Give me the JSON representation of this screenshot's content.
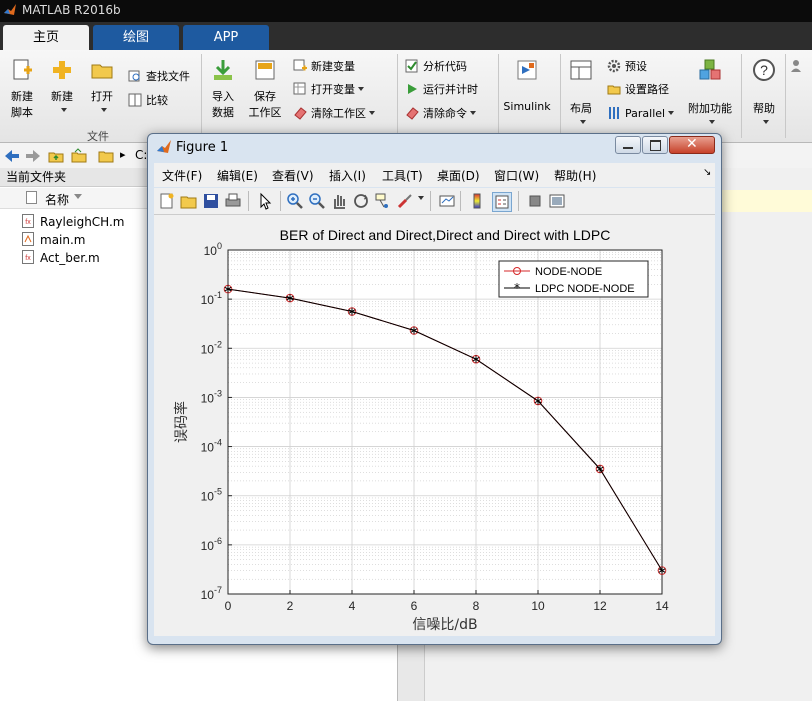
{
  "app": {
    "title": "MATLAB R2016b"
  },
  "tabs": [
    {
      "label": "主页"
    },
    {
      "label": "绘图"
    },
    {
      "label": "APP"
    }
  ],
  "ribbon": {
    "new_script": [
      "新建",
      "脚本"
    ],
    "new": "新建",
    "open": "打开",
    "find_files": "查找文件",
    "compare": "比较",
    "import": [
      "导入",
      "数据"
    ],
    "save_ws": [
      "保存",
      "工作区"
    ],
    "new_var": "新建变量",
    "open_var": "打开变量",
    "clear_ws": "清除工作区",
    "analyze_code": "分析代码",
    "run_time": "运行并计时",
    "clear_cmd": "清除命令",
    "simulink": "Simulink",
    "layout": "布局",
    "prefs": "预设",
    "set_path": "设置路径",
    "parallel": "Parallel",
    "addons": "附加功能",
    "help": "帮助",
    "group_file": "文件"
  },
  "address": {
    "path": "C:"
  },
  "current_folder": {
    "header": "当前文件夹",
    "col_name": "名称",
    "files": [
      {
        "name": "RayleighCH.m"
      },
      {
        "name": "main.m"
      },
      {
        "name": "Act_ber.m"
      }
    ]
  },
  "figure": {
    "title": "Figure 1",
    "menu": [
      "文件(F)",
      "编辑(E)",
      "查看(V)",
      "插入(I)",
      "工具(T)",
      "桌面(D)",
      "窗口(W)",
      "帮助(H)"
    ]
  },
  "chart_data": {
    "type": "line",
    "title": "BER of Direct and Direct,Direct and Direct with LDPC",
    "xlabel": "信噪比/dB",
    "ylabel": "误码率",
    "xlim": [
      0,
      14
    ],
    "ylim": [
      1e-07,
      1
    ],
    "yscale": "log",
    "grid": true,
    "legend_position": "top-right",
    "x_ticks": [
      "0",
      "2",
      "4",
      "6",
      "8",
      "10",
      "12",
      "14"
    ],
    "y_tick_exponents": [
      "0",
      "-1",
      "-2",
      "-3",
      "-4",
      "-5",
      "-6",
      "-7"
    ],
    "x": [
      0,
      2,
      4,
      6,
      8,
      10,
      12,
      14
    ],
    "series": [
      {
        "name": "NODE-NODE",
        "color": "#d62728",
        "marker": "o",
        "values": [
          0.16,
          0.105,
          0.056,
          0.023,
          0.006,
          0.00085,
          3.5e-05,
          3e-07
        ]
      },
      {
        "name": "LDPC NODE-NODE",
        "color": "#000000",
        "marker": "*",
        "values": [
          0.16,
          0.105,
          0.056,
          0.023,
          0.006,
          0.00085,
          3.5e-05,
          3e-07
        ]
      }
    ]
  }
}
